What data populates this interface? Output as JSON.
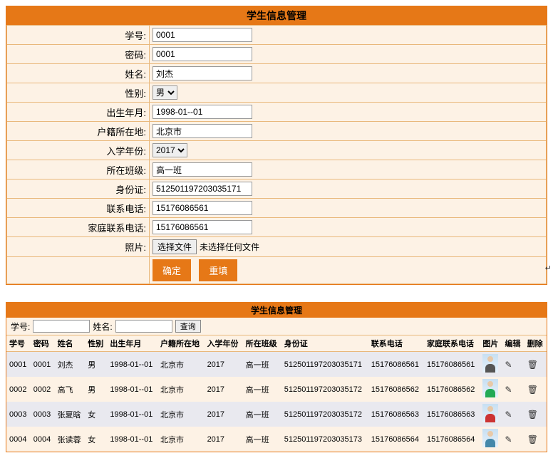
{
  "form_panel": {
    "title": "学生信息管理",
    "labels": {
      "id": "学号:",
      "pwd": "密码:",
      "name": "姓名:",
      "gender": "性别:",
      "birth": "出生年月:",
      "residence": "户籍所在地:",
      "enroll": "入学年份:",
      "class": "所在班级:",
      "idcard": "身份证:",
      "phone": "联系电话:",
      "home_phone": "家庭联系电话:",
      "photo": "照片:"
    },
    "values": {
      "id": "0001",
      "pwd": "0001",
      "name": "刘杰",
      "gender": "男",
      "birth": "1998-01--01",
      "residence": "北京市",
      "enroll": "2017",
      "class": "高一班",
      "idcard": "512501197203035171",
      "phone": "15176086561",
      "home_phone": "15176086561"
    },
    "file_button": "选择文件",
    "file_status": "未选择任何文件",
    "submit": "确定",
    "reset": "重填"
  },
  "list_panel": {
    "title": "学生信息管理",
    "search_id_label": "学号:",
    "search_name_label": "姓名:",
    "search_button": "查询",
    "headers": [
      "学号",
      "密码",
      "姓名",
      "性别",
      "出生年月",
      "户籍所在地",
      "入学年份",
      "所在班级",
      "身份证",
      "联系电话",
      "家庭联系电话",
      "图片",
      "编辑",
      "删除"
    ],
    "rows": [
      {
        "id": "0001",
        "pwd": "0001",
        "name": "刘杰",
        "gender": "男",
        "birth": "1998-01--01",
        "residence": "北京市",
        "enroll": "2017",
        "class": "高一班",
        "idcard": "512501197203035171",
        "phone": "15176086561",
        "home_phone": "15176086561"
      },
      {
        "id": "0002",
        "pwd": "0002",
        "name": "高飞",
        "gender": "男",
        "birth": "1998-01--01",
        "residence": "北京市",
        "enroll": "2017",
        "class": "高一班",
        "idcard": "512501197203035172",
        "phone": "15176086562",
        "home_phone": "15176086562"
      },
      {
        "id": "0003",
        "pwd": "0003",
        "name": "张夏晗",
        "gender": "女",
        "birth": "1998-01--01",
        "residence": "北京市",
        "enroll": "2017",
        "class": "高一班",
        "idcard": "512501197203035172",
        "phone": "15176086563",
        "home_phone": "15176086563"
      },
      {
        "id": "0004",
        "pwd": "0004",
        "name": "张读蓉",
        "gender": "女",
        "birth": "1998-01--01",
        "residence": "北京市",
        "enroll": "2017",
        "class": "高一班",
        "idcard": "512501197203035173",
        "phone": "15176086564",
        "home_phone": "15176086564"
      }
    ]
  }
}
